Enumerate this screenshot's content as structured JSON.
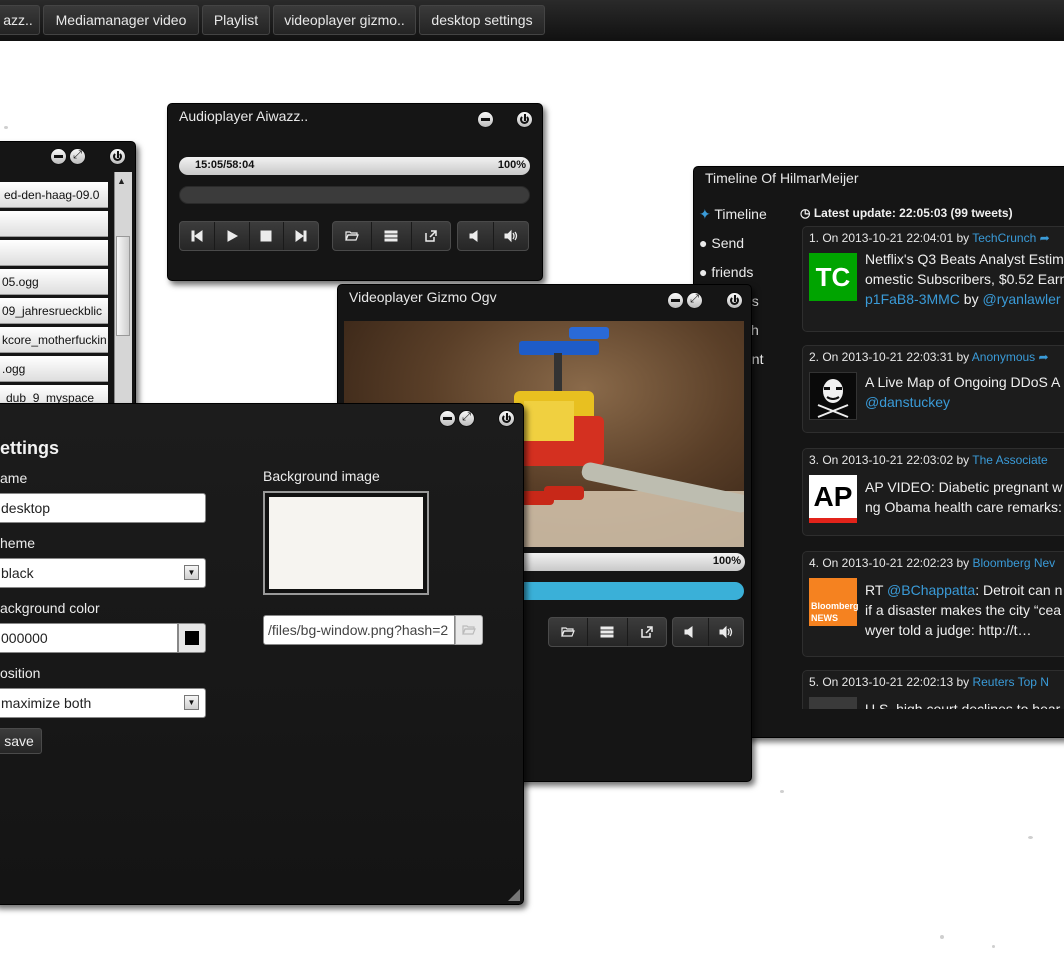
{
  "taskbar": {
    "tabs": [
      "azz..",
      "Mediamanager video",
      "Playlist",
      "videoplayer gizmo..",
      "desktop settings"
    ]
  },
  "playlist_window": {
    "items": [
      "ed-den-haag-09.0",
      "",
      "",
      "05.ogg",
      "09_jahresrueckblic",
      "kcore_motherfuckin",
      ".ogg",
      "dub_9_myspace"
    ]
  },
  "audioplayer": {
    "title": "Audioplayer Aiwazz..",
    "time": "15:05/58:04",
    "volume": "100%"
  },
  "videoplayer": {
    "title": "Videoplayer Gizmo Ogv",
    "volume": "100%"
  },
  "timeline": {
    "title": "Timeline Of HilmarMeijer",
    "nav": [
      "Timeline",
      "Send",
      "friends",
      "ds",
      "ch",
      "unt"
    ],
    "latest_update": "Latest update: 22:05:03 (99 tweets)",
    "tweets": [
      {
        "meta_prefix": "1. On 2013-10-21 22:04:01 by",
        "author": "TechCrunch",
        "logo": "TC",
        "line1": "Netflix's Q3 Beats Analyst Estim",
        "line2": "omestic Subscribers, $0.52 Earn",
        "line3_link": "p1FaB8-3MMC",
        "line3_by": " by ",
        "line3_user": "@ryanlawler"
      },
      {
        "meta_prefix": "2. On 2013-10-21 22:03:31 by",
        "author": "Anonymous",
        "logo": "anon",
        "line1": "A Live Map of Ongoing DDoS A",
        "line2_user": "@danstuckey"
      },
      {
        "meta_prefix": "3. On 2013-10-21 22:03:02 by",
        "author": "The Associate",
        "logo": "AP",
        "line1": "AP VIDEO: Diabetic pregnant w",
        "line2": "ng Obama health care remarks:"
      },
      {
        "meta_prefix": "4. On 2013-10-21 22:02:23 by",
        "author": "Bloomberg Nev",
        "logo": "Bloomberg NEWS",
        "line1_pre": "RT ",
        "line1_user": "@BChappatta",
        "line1_post": ": Detroit can n",
        "line2": "if a disaster makes the city “cea",
        "line3": "wyer told a judge: http://t…"
      },
      {
        "meta_prefix": "5. On 2013-10-21 22:02:13 by",
        "author": "Reuters Top N",
        "line1": "U.S. high court declines to hear"
      }
    ]
  },
  "settings": {
    "title": "ettings",
    "name_label": "ame",
    "name_value": "desktop",
    "theme_label": "heme",
    "theme_value": "black",
    "bgcolor_label": "ackground color",
    "bgcolor_value": "000000",
    "bgcolor_swatch": "#000000",
    "position_label": "osition",
    "position_value": "maximize both",
    "save_label": "save",
    "bgimage_label": "Background image",
    "bgimage_path": "/files/bg-window.png?hash=2"
  },
  "colors": {
    "link": "#3a9bd8",
    "video_bar": "#3ab0d8"
  }
}
